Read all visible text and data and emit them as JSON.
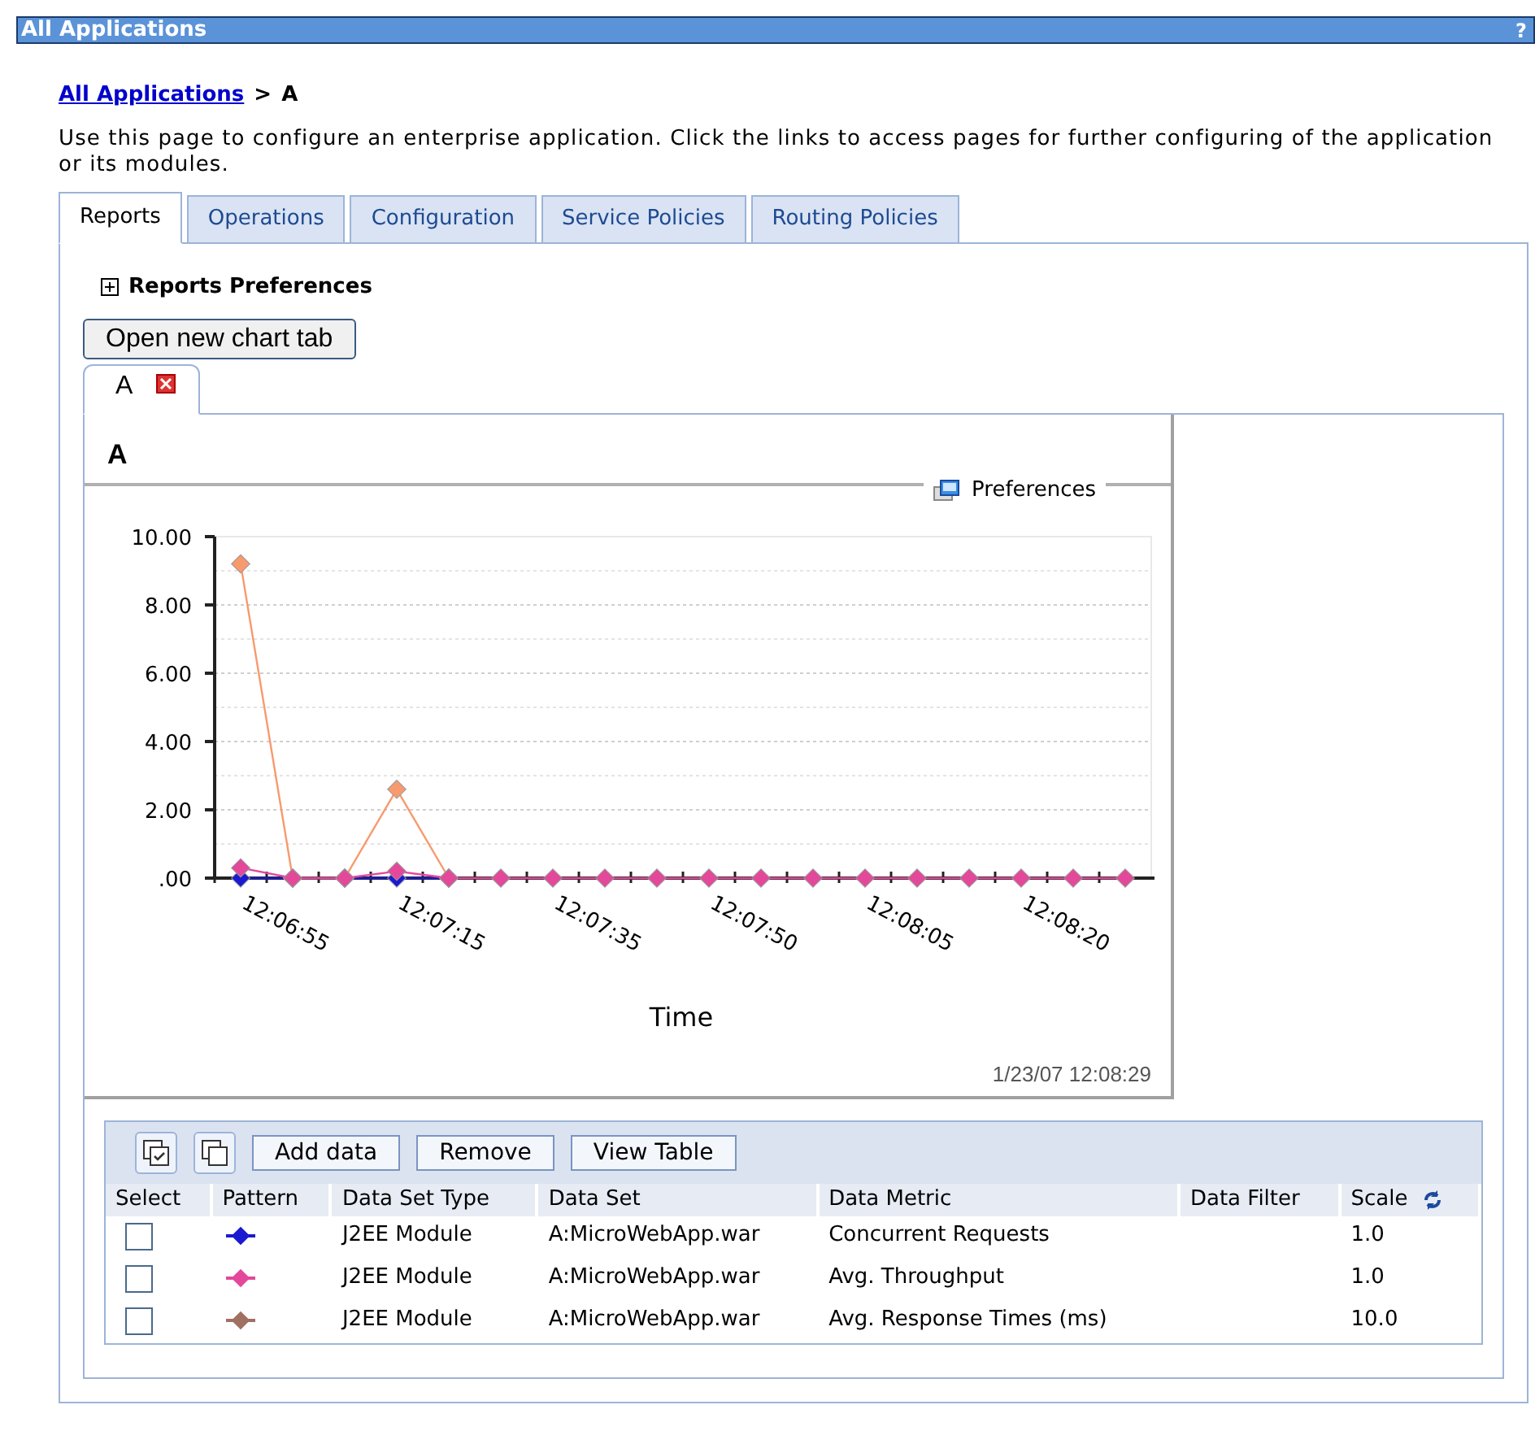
{
  "window": {
    "title": "All Applications",
    "help": "?"
  },
  "breadcrumb": {
    "link": "All Applications",
    "separator": ">",
    "current": "A"
  },
  "description": "Use this page to configure an enterprise application. Click the links to access pages for further configuring of the application or its modules.",
  "tabs": [
    {
      "label": "Reports",
      "selected": true
    },
    {
      "label": "Operations",
      "selected": false
    },
    {
      "label": "Configuration",
      "selected": false
    },
    {
      "label": "Service Policies",
      "selected": false
    },
    {
      "label": "Routing Policies",
      "selected": false
    }
  ],
  "reports_preferences": {
    "label": "Reports Preferences",
    "expanded": false
  },
  "open_chart_button": "Open new chart tab",
  "chart_tabs": [
    {
      "label": "A",
      "selected": true
    }
  ],
  "chart_panel": {
    "title": "A",
    "preferences": "Preferences",
    "timestamp": "1/23/07 12:08:29",
    "chart_data": {
      "type": "line",
      "xlabel": "Time",
      "categories": [
        "12:06:55",
        null,
        null,
        "12:07:15",
        null,
        null,
        "12:07:35",
        null,
        null,
        "12:07:50",
        null,
        null,
        "12:08:05",
        null,
        null,
        "12:08:20",
        null,
        null
      ],
      "ylim": [
        0,
        10
      ],
      "grid": true,
      "yticks": [
        {
          "value": 0,
          "label": ".00"
        },
        {
          "value": 2,
          "label": "2.00"
        },
        {
          "value": 4,
          "label": "4.00"
        },
        {
          "value": 6,
          "label": "6.00"
        },
        {
          "value": 8,
          "label": "8.00"
        },
        {
          "value": 10,
          "label": "10.00"
        }
      ],
      "series": [
        {
          "color": "#1a1ad0",
          "marker": "diamond",
          "values": [
            0,
            0,
            0,
            0,
            0,
            null,
            null,
            null,
            null,
            null,
            null,
            null,
            null,
            null,
            null,
            null,
            null,
            null
          ]
        },
        {
          "color": "#f79a6e",
          "marker": "diamond",
          "values": [
            9.2,
            0,
            0,
            2.6,
            0,
            null,
            null,
            null,
            null,
            null,
            null,
            null,
            null,
            null,
            null,
            null,
            null,
            null
          ]
        },
        {
          "color": "#e4489a",
          "marker": "diamond",
          "values": [
            0.3,
            0,
            0,
            0.2,
            0,
            0,
            0,
            0,
            0,
            0,
            0,
            0,
            0,
            0,
            0,
            0,
            0,
            0
          ]
        }
      ]
    }
  },
  "data_toolbar": {
    "buttons": [
      "Add data",
      "Remove",
      "View Table"
    ]
  },
  "table": {
    "columns": [
      "Select",
      "Pattern",
      "Data Set Type",
      "Data Set",
      "Data Metric",
      "Data Filter",
      "Scale"
    ],
    "rows": [
      {
        "checked": false,
        "color": "#1a1ad0",
        "type": "J2EE Module",
        "data_set": "A:MicroWebApp.war",
        "metric": "Concurrent Requests",
        "scale": "1.0"
      },
      {
        "checked": false,
        "color": "#e4489a",
        "type": "J2EE Module",
        "data_set": "A:MicroWebApp.war",
        "metric": "Avg. Throughput",
        "scale": "1.0"
      },
      {
        "checked": false,
        "color": "#a07060",
        "type": "J2EE Module",
        "data_set": "A:MicroWebApp.war",
        "metric": "Avg. Response Times (ms)",
        "scale": "10.0"
      }
    ]
  }
}
